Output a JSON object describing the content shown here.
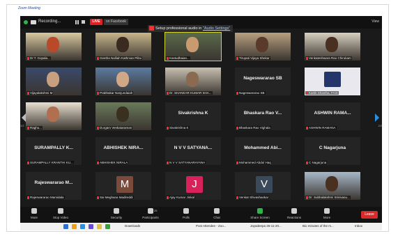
{
  "window": {
    "title": "Zoom Meeting"
  },
  "topbar": {
    "recording": "Recording...",
    "live_badge": "LIVE",
    "live_target": "on Facebook",
    "view_label": "View"
  },
  "notice": {
    "prefix": "Setup professional audio in",
    "link": "\"Audio Settings\""
  },
  "tiles": [
    {
      "big": "",
      "name": "Dr.T. Gopala...",
      "kind": "video",
      "bg": "#d9c9a0",
      "accent": "#b84a2a"
    },
    {
      "big": "",
      "name": "Geetha Nalliah Kathrvan Pillai",
      "kind": "video",
      "bg": "#c8b58a",
      "accent": "#3a2a20"
    },
    {
      "big": "",
      "name": "Kastudhaian...",
      "kind": "video",
      "bg": "#5a6a4a",
      "accent": "#c99a70",
      "active": true
    },
    {
      "big": "",
      "name": "Tirupati Vijaya Shekar",
      "kind": "video",
      "bg": "#b8a080",
      "accent": "#5a3a2a"
    },
    {
      "big": "",
      "name": "Venkateshwara Rao Chirukam",
      "kind": "video",
      "bg": "#d8d0c0",
      "accent": "#4a3020"
    },
    {
      "big": "",
      "name": "Vijayalakshmi M",
      "kind": "video",
      "bg": "#3a4a6a",
      "accent": "#c8a080"
    },
    {
      "big": "",
      "name": "Prabhakar Nanjundaiah",
      "kind": "video",
      "bg": "#5a7aa0",
      "accent": "#d0a888"
    },
    {
      "big": "",
      "name": "Dr. SHANKAR KUMAR SHA...",
      "kind": "video",
      "bg": "#c8c0b0",
      "accent": "#8a6a50"
    },
    {
      "big": "Nageswararao SB",
      "name": "Nageswararao SB",
      "kind": "text"
    },
    {
      "big": "",
      "name": "Kartik Shantha, FAIS",
      "kind": "logo"
    },
    {
      "big": "",
      "name": "Raghu...",
      "kind": "video",
      "bg": "#e8e0d0",
      "accent": "#b07050"
    },
    {
      "big": "",
      "name": "Durgam Venkataraman",
      "kind": "video",
      "bg": "#6a7a5a",
      "accent": "#3a3020"
    },
    {
      "big": "Sivakrishna K",
      "name": "Sivakrishna K",
      "kind": "text"
    },
    {
      "big": "Bhaskara Rao V...",
      "name": "Bhaskara Rao Vighala",
      "kind": "text"
    },
    {
      "big": "ASHWIN RAMA...",
      "name": "ASHWIN RAMANA",
      "kind": "text"
    },
    {
      "big": "SURAMPALLY K...",
      "name": "SURAMPALLY KRANTHI KU...",
      "kind": "text"
    },
    {
      "big": "ABHISHEK NIRA...",
      "name": "ABHISHEK NIRALA",
      "kind": "text"
    },
    {
      "big": "N V V SATYANA...",
      "name": "N V V SATYANARAYANA",
      "kind": "text"
    },
    {
      "big": "Mohammed Abi...",
      "name": "Mohammed Abdul Haq",
      "kind": "text"
    },
    {
      "big": "C Nagarjuna",
      "name": "C Nagarjuna",
      "kind": "text"
    },
    {
      "big": "Rajeswararao M...",
      "name": "Rajeswararao Mamidala",
      "kind": "text"
    },
    {
      "big": "M",
      "name": "Sai Meghana Madireddi",
      "kind": "avatar",
      "color": "#7a4a3a"
    },
    {
      "big": "J",
      "name": "Ajay Kumar Jinkal",
      "kind": "avatar",
      "color": "#d8205a"
    },
    {
      "big": "V",
      "name": "Venkat Shivashankar",
      "kind": "avatar",
      "color": "#3a4a5a"
    },
    {
      "big": "",
      "name": "Dr. Subhalakshmi Srinivasu...",
      "kind": "video",
      "bg": "#a8b8c8",
      "accent": "#4a3020"
    }
  ],
  "pager": {
    "left": "1/2",
    "right": "2/2"
  },
  "toolbar": [
    {
      "label": "Mute",
      "icon": "microphone-icon"
    },
    {
      "label": "Stop Video",
      "icon": "video-camera-icon"
    },
    {
      "label": "Security",
      "icon": "shield-icon"
    },
    {
      "label": "Participants",
      "icon": "participants-icon",
      "count": "25"
    },
    {
      "label": "Polls",
      "icon": "polls-icon"
    },
    {
      "label": "Chat",
      "icon": "chat-icon"
    },
    {
      "label": "Share Screen",
      "icon": "share-screen-icon"
    },
    {
      "label": "Reactions",
      "icon": "reactions-icon"
    },
    {
      "label": "More",
      "icon": "more-icon"
    }
  ],
  "leave_label": "Leave",
  "taskbar": [
    {
      "label": "Downloads"
    },
    {
      "label": "Post Attendee - Zoo..."
    },
    {
      "label": "Jayadeepa 26-11-20..."
    },
    {
      "label": "Bio minutes of the m..."
    },
    {
      "label": "Inbox"
    }
  ]
}
